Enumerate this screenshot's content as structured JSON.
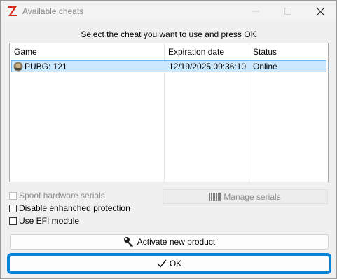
{
  "window": {
    "title": "Available cheats",
    "app_icon": "z-logo-icon"
  },
  "instruction": "Select the cheat you want to use and press OK",
  "list": {
    "columns": [
      "Game",
      "Expiration date",
      "Status"
    ],
    "rows": [
      {
        "game": "PUBG: 121",
        "expiration": "12/19/2025 09:36:10",
        "status": "Online",
        "icon": "pubg-game-icon",
        "selected": true
      }
    ]
  },
  "options": {
    "spoof_label": "Spoof hardware serials",
    "spoof_checked": false,
    "spoof_enabled": false,
    "disable_protection_label": "Disable enhanched protection",
    "disable_protection_checked": false,
    "efi_label": "Use EFI module",
    "efi_checked": false
  },
  "buttons": {
    "manage_serials": "Manage serials",
    "activate": "Activate new product",
    "ok": "OK"
  },
  "colors": {
    "selection_bg": "#cce8ff",
    "focus_border": "#0a84d8",
    "logo_red": "#d9261c"
  }
}
